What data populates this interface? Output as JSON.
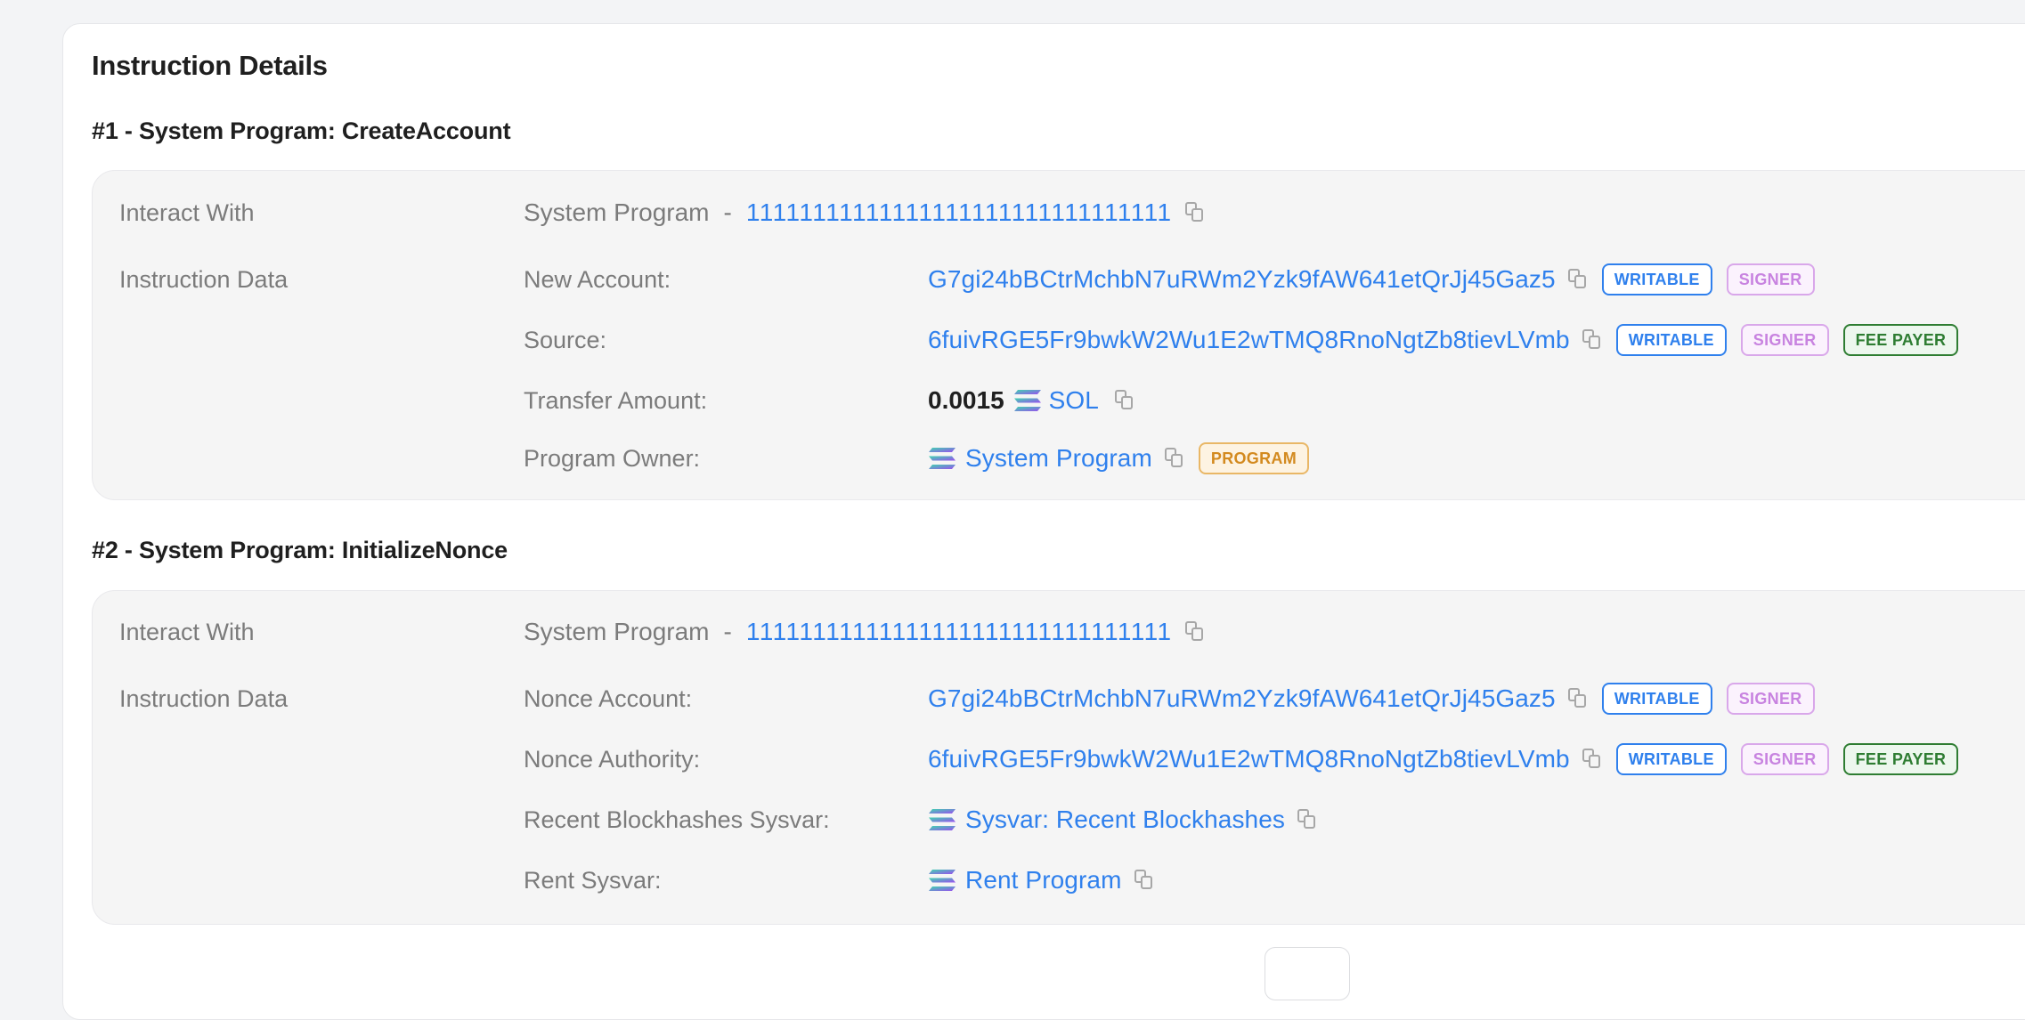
{
  "card": {
    "title": "Instruction Details"
  },
  "instructions": [
    {
      "title": "#1 - System Program: CreateAccount",
      "interact_label": "Interact With",
      "program_name": "System Program",
      "separator": "-",
      "program_id": "11111111111111111111111111111111",
      "data_label": "Instruction Data",
      "fields": [
        {
          "label": "New Account:",
          "value": "G7gi24bBCtrMchbN7uRWm2Yzk9fAW641etQrJj45Gaz5",
          "badges": [
            "WRITABLE",
            "SIGNER"
          ]
        },
        {
          "label": "Source:",
          "value": "6fuivRGE5Fr9bwkW2Wu1E2wTMQ8RnoNgtZb8tievLVmb",
          "badges": [
            "WRITABLE",
            "SIGNER",
            "FEE PAYER"
          ]
        },
        {
          "label": "Transfer Amount:",
          "amount": "0.0015",
          "token": "SOL",
          "token_icon": "solana-icon"
        },
        {
          "label": "Program Owner:",
          "value": "System Program",
          "icon": "solana-icon",
          "badges": [
            "PROGRAM"
          ]
        }
      ]
    },
    {
      "title": "#2 - System Program: InitializeNonce",
      "interact_label": "Interact With",
      "program_name": "System Program",
      "separator": "-",
      "program_id": "11111111111111111111111111111111",
      "data_label": "Instruction Data",
      "fields": [
        {
          "label": "Nonce Account:",
          "value": "G7gi24bBCtrMchbN7uRWm2Yzk9fAW641etQrJj45Gaz5",
          "badges": [
            "WRITABLE",
            "SIGNER"
          ]
        },
        {
          "label": "Nonce Authority:",
          "value": "6fuivRGE5Fr9bwkW2Wu1E2wTMQ8RnoNgtZb8tievLVmb",
          "badges": [
            "WRITABLE",
            "SIGNER",
            "FEE PAYER"
          ]
        },
        {
          "label": "Recent Blockhashes Sysvar:",
          "value": "Sysvar: Recent Blockhashes",
          "icon": "solana-icon"
        },
        {
          "label": "Rent Sysvar:",
          "value": "Rent Program",
          "icon": "solana-icon"
        }
      ]
    }
  ],
  "colors": {
    "link": "#2f80ed",
    "writable": "#2f80ed",
    "signer": "#c883e0",
    "fee_payer": "#2e7d32",
    "program": "#d38a1f"
  }
}
